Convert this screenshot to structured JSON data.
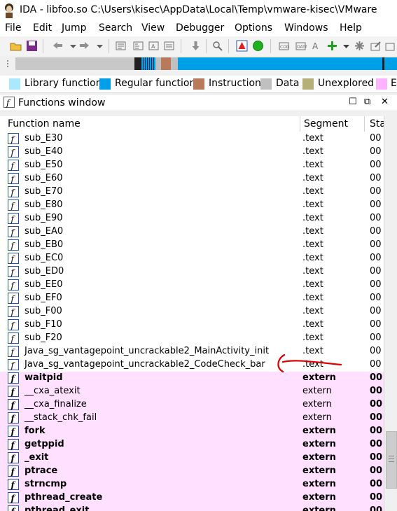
{
  "window": {
    "title": "IDA - libfoo.so C:\\Users\\kisec\\AppData\\Local\\Temp\\vmware-kisec\\VMware"
  },
  "menu": [
    "File",
    "Edit",
    "Jump",
    "Search",
    "View",
    "Debugger",
    "Options",
    "Windows",
    "Help"
  ],
  "toolbar": {
    "icons": [
      "open-folder-icon",
      "save-icon",
      "back-arrow-icon",
      "forward-arrow-icon",
      "list-icon",
      "hex-view-icon",
      "functions-icon",
      "names-icon",
      "down-arrow-icon",
      "search-icon",
      "stop-icon",
      "run-icon",
      "code-icon",
      "data-icon",
      "string-icon",
      "add-icon",
      "gear-icon",
      "edit-icon"
    ]
  },
  "legend": [
    {
      "label": "Library function",
      "color": "#aae8ff"
    },
    {
      "label": "Regular function",
      "color": "#00a0e8"
    },
    {
      "label": "Instruction",
      "color": "#b87a5a"
    },
    {
      "label": "Data",
      "color": "#c0c0c0"
    },
    {
      "label": "Unexplored",
      "color": "#b4b078"
    },
    {
      "label": "E",
      "color": "#ffb0ff"
    }
  ],
  "functions_window": {
    "title": "Functions window",
    "columns": {
      "name": "Function name",
      "segment": "Segment",
      "start": "Sta"
    },
    "rows": [
      {
        "name": "sub_E30",
        "segment": ".text",
        "start": "00",
        "kind": "regular"
      },
      {
        "name": "sub_E40",
        "segment": ".text",
        "start": "00",
        "kind": "regular"
      },
      {
        "name": "sub_E50",
        "segment": ".text",
        "start": "00",
        "kind": "regular"
      },
      {
        "name": "sub_E60",
        "segment": ".text",
        "start": "00",
        "kind": "regular"
      },
      {
        "name": "sub_E70",
        "segment": ".text",
        "start": "00",
        "kind": "regular"
      },
      {
        "name": "sub_E80",
        "segment": ".text",
        "start": "00",
        "kind": "regular"
      },
      {
        "name": "sub_E90",
        "segment": ".text",
        "start": "00",
        "kind": "regular"
      },
      {
        "name": "sub_EA0",
        "segment": ".text",
        "start": "00",
        "kind": "regular"
      },
      {
        "name": "sub_EB0",
        "segment": ".text",
        "start": "00",
        "kind": "regular"
      },
      {
        "name": "sub_EC0",
        "segment": ".text",
        "start": "00",
        "kind": "regular"
      },
      {
        "name": "sub_ED0",
        "segment": ".text",
        "start": "00",
        "kind": "regular"
      },
      {
        "name": "sub_EE0",
        "segment": ".text",
        "start": "00",
        "kind": "regular"
      },
      {
        "name": "sub_EF0",
        "segment": ".text",
        "start": "00",
        "kind": "regular"
      },
      {
        "name": "sub_F00",
        "segment": ".text",
        "start": "00",
        "kind": "regular"
      },
      {
        "name": "sub_F10",
        "segment": ".text",
        "start": "00",
        "kind": "regular"
      },
      {
        "name": "sub_F20",
        "segment": ".text",
        "start": "00",
        "kind": "regular"
      },
      {
        "name": "Java_sg_vantagepoint_uncrackable2_MainActivity_init",
        "segment": ".text",
        "start": "00",
        "kind": "regular"
      },
      {
        "name": "Java_sg_vantagepoint_uncrackable2_CodeCheck_bar",
        "segment": ".text",
        "start": "00",
        "kind": "regular"
      },
      {
        "name": "waitpid",
        "segment": "extern",
        "start": "00",
        "kind": "extern"
      },
      {
        "name": "__cxa_atexit",
        "segment": "extern",
        "start": "00",
        "kind": "extern2"
      },
      {
        "name": "__cxa_finalize",
        "segment": "extern",
        "start": "00",
        "kind": "extern2"
      },
      {
        "name": "__stack_chk_fail",
        "segment": "extern",
        "start": "00",
        "kind": "extern2"
      },
      {
        "name": "fork",
        "segment": "extern",
        "start": "00",
        "kind": "extern"
      },
      {
        "name": "getppid",
        "segment": "extern",
        "start": "00",
        "kind": "extern"
      },
      {
        "name": "_exit",
        "segment": "extern",
        "start": "00",
        "kind": "extern"
      },
      {
        "name": "ptrace",
        "segment": "extern",
        "start": "00",
        "kind": "extern"
      },
      {
        "name": "strncmp",
        "segment": "extern",
        "start": "00",
        "kind": "extern"
      },
      {
        "name": "pthread_create",
        "segment": "extern",
        "start": "00",
        "kind": "extern"
      },
      {
        "name": "pthread_exit",
        "segment": "extern",
        "start": "00",
        "kind": "extern"
      }
    ]
  },
  "annotation": {
    "color": "#e00000"
  }
}
